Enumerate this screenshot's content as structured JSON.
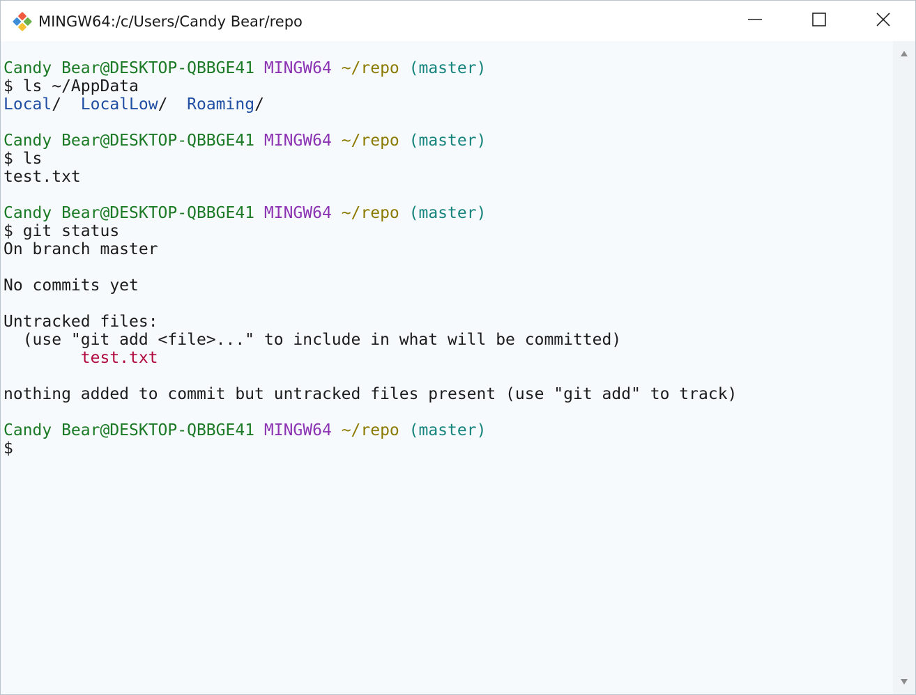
{
  "window": {
    "title": "MINGW64:/c/Users/Candy Bear/repo"
  },
  "colors": {
    "user_host": "#1b7a25",
    "shell": "#8b33b3",
    "path": "#8a7a00",
    "branch": "#17847e",
    "directory": "#1f4ea3",
    "untracked_file": "#b10a3f"
  },
  "terminal": {
    "lines": [
      [
        {
          "t": "Candy Bear@DESKTOP-QBBGE41",
          "c": "c-green"
        },
        {
          "t": " ",
          "c": "c-default"
        },
        {
          "t": "MINGW64",
          "c": "c-purple"
        },
        {
          "t": " ",
          "c": "c-default"
        },
        {
          "t": "~/repo",
          "c": "c-olive"
        },
        {
          "t": " ",
          "c": "c-default"
        },
        {
          "t": "(master)",
          "c": "c-teal"
        }
      ],
      [
        {
          "t": "$ ls ~/AppData",
          "c": "c-default"
        }
      ],
      [
        {
          "t": "Local",
          "c": "c-blue"
        },
        {
          "t": "/  ",
          "c": "c-default"
        },
        {
          "t": "LocalLow",
          "c": "c-blue"
        },
        {
          "t": "/  ",
          "c": "c-default"
        },
        {
          "t": "Roaming",
          "c": "c-blue"
        },
        {
          "t": "/",
          "c": "c-default"
        }
      ],
      [
        {
          "t": "",
          "c": "c-default"
        }
      ],
      [
        {
          "t": "Candy Bear@DESKTOP-QBBGE41",
          "c": "c-green"
        },
        {
          "t": " ",
          "c": "c-default"
        },
        {
          "t": "MINGW64",
          "c": "c-purple"
        },
        {
          "t": " ",
          "c": "c-default"
        },
        {
          "t": "~/repo",
          "c": "c-olive"
        },
        {
          "t": " ",
          "c": "c-default"
        },
        {
          "t": "(master)",
          "c": "c-teal"
        }
      ],
      [
        {
          "t": "$ ls",
          "c": "c-default"
        }
      ],
      [
        {
          "t": "test.txt",
          "c": "c-default"
        }
      ],
      [
        {
          "t": "",
          "c": "c-default"
        }
      ],
      [
        {
          "t": "Candy Bear@DESKTOP-QBBGE41",
          "c": "c-green"
        },
        {
          "t": " ",
          "c": "c-default"
        },
        {
          "t": "MINGW64",
          "c": "c-purple"
        },
        {
          "t": " ",
          "c": "c-default"
        },
        {
          "t": "~/repo",
          "c": "c-olive"
        },
        {
          "t": " ",
          "c": "c-default"
        },
        {
          "t": "(master)",
          "c": "c-teal"
        }
      ],
      [
        {
          "t": "$ git status",
          "c": "c-default"
        }
      ],
      [
        {
          "t": "On branch master",
          "c": "c-default"
        }
      ],
      [
        {
          "t": "",
          "c": "c-default"
        }
      ],
      [
        {
          "t": "No commits yet",
          "c": "c-default"
        }
      ],
      [
        {
          "t": "",
          "c": "c-default"
        }
      ],
      [
        {
          "t": "Untracked files:",
          "c": "c-default"
        }
      ],
      [
        {
          "t": "  (use \"git add <file>...\" to include in what will be committed)",
          "c": "c-default"
        }
      ],
      [
        {
          "t": "        ",
          "c": "c-default"
        },
        {
          "t": "test.txt",
          "c": "c-red"
        }
      ],
      [
        {
          "t": "",
          "c": "c-default"
        }
      ],
      [
        {
          "t": "nothing added to commit but untracked files present (use \"git add\" to track)",
          "c": "c-default"
        }
      ],
      [
        {
          "t": "",
          "c": "c-default"
        }
      ],
      [
        {
          "t": "Candy Bear@DESKTOP-QBBGE41",
          "c": "c-green"
        },
        {
          "t": " ",
          "c": "c-default"
        },
        {
          "t": "MINGW64",
          "c": "c-purple"
        },
        {
          "t": " ",
          "c": "c-default"
        },
        {
          "t": "~/repo",
          "c": "c-olive"
        },
        {
          "t": " ",
          "c": "c-default"
        },
        {
          "t": "(master)",
          "c": "c-teal"
        }
      ],
      [
        {
          "t": "$",
          "c": "c-default"
        }
      ]
    ]
  },
  "icons": {
    "app": "git-bash-icon",
    "minimize": "minimize-icon",
    "maximize": "maximize-icon",
    "close": "close-icon",
    "scroll_up": "triangle-up-icon",
    "scroll_down": "triangle-down-icon"
  }
}
